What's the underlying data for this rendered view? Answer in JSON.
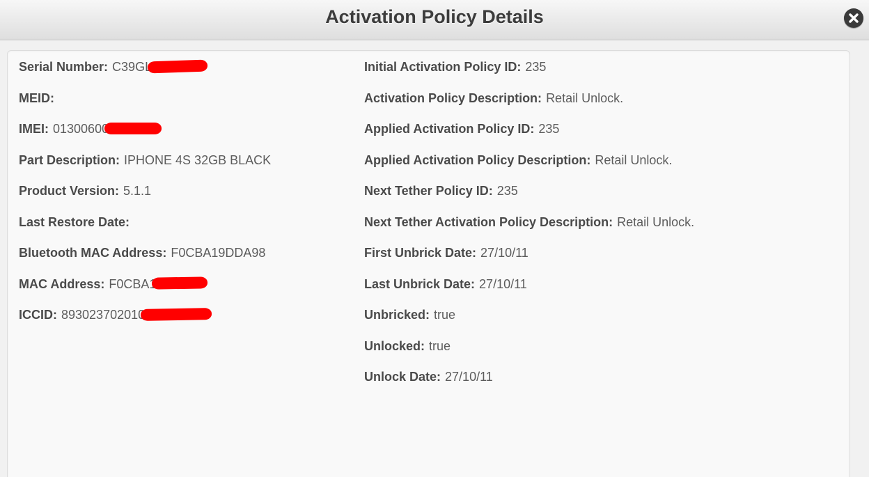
{
  "window": {
    "title": "Activation Policy Details",
    "close_icon": "close-circle-icon"
  },
  "left": [
    {
      "label": "Serial Number:",
      "value": "C39GL",
      "redacted": true
    },
    {
      "label": "MEID:",
      "value": ""
    },
    {
      "label": "IMEI:",
      "value": "01300600",
      "redacted": true
    },
    {
      "label": "Part Description:",
      "value": "IPHONE 4S 32GB BLACK"
    },
    {
      "label": "Product Version:",
      "value": "5.1.1"
    },
    {
      "label": "Last Restore Date:",
      "value": ""
    },
    {
      "label": "Bluetooth MAC Address:",
      "value": "F0CBA19DDA98"
    },
    {
      "label": "MAC Address:",
      "value": "F0CBA1",
      "redacted": true
    },
    {
      "label": "ICCID:",
      "value": "893023702010",
      "redacted": true
    }
  ],
  "right": [
    {
      "label": "Initial Activation Policy ID:",
      "value": "235"
    },
    {
      "label": "Activation Policy Description:",
      "value": "Retail Unlock."
    },
    {
      "label": "Applied Activation Policy ID:",
      "value": "235"
    },
    {
      "label": "Applied Activation Policy Description:",
      "value": "Retail Unlock."
    },
    {
      "label": "Next Tether Policy ID:",
      "value": "235"
    },
    {
      "label": "Next Tether Activation Policy Description:",
      "value": "Retail Unlock."
    },
    {
      "label": "First Unbrick Date:",
      "value": "27/10/11"
    },
    {
      "label": "Last Unbrick Date:",
      "value": "27/10/11"
    },
    {
      "label": "Unbricked:",
      "value": "true"
    },
    {
      "label": "Unlocked:",
      "value": "true"
    },
    {
      "label": "Unlock Date:",
      "value": "27/10/11"
    }
  ],
  "colors": {
    "redaction": "#ff0000",
    "title_text": "#3c3c3c",
    "close_button": "#3a3a3a"
  }
}
